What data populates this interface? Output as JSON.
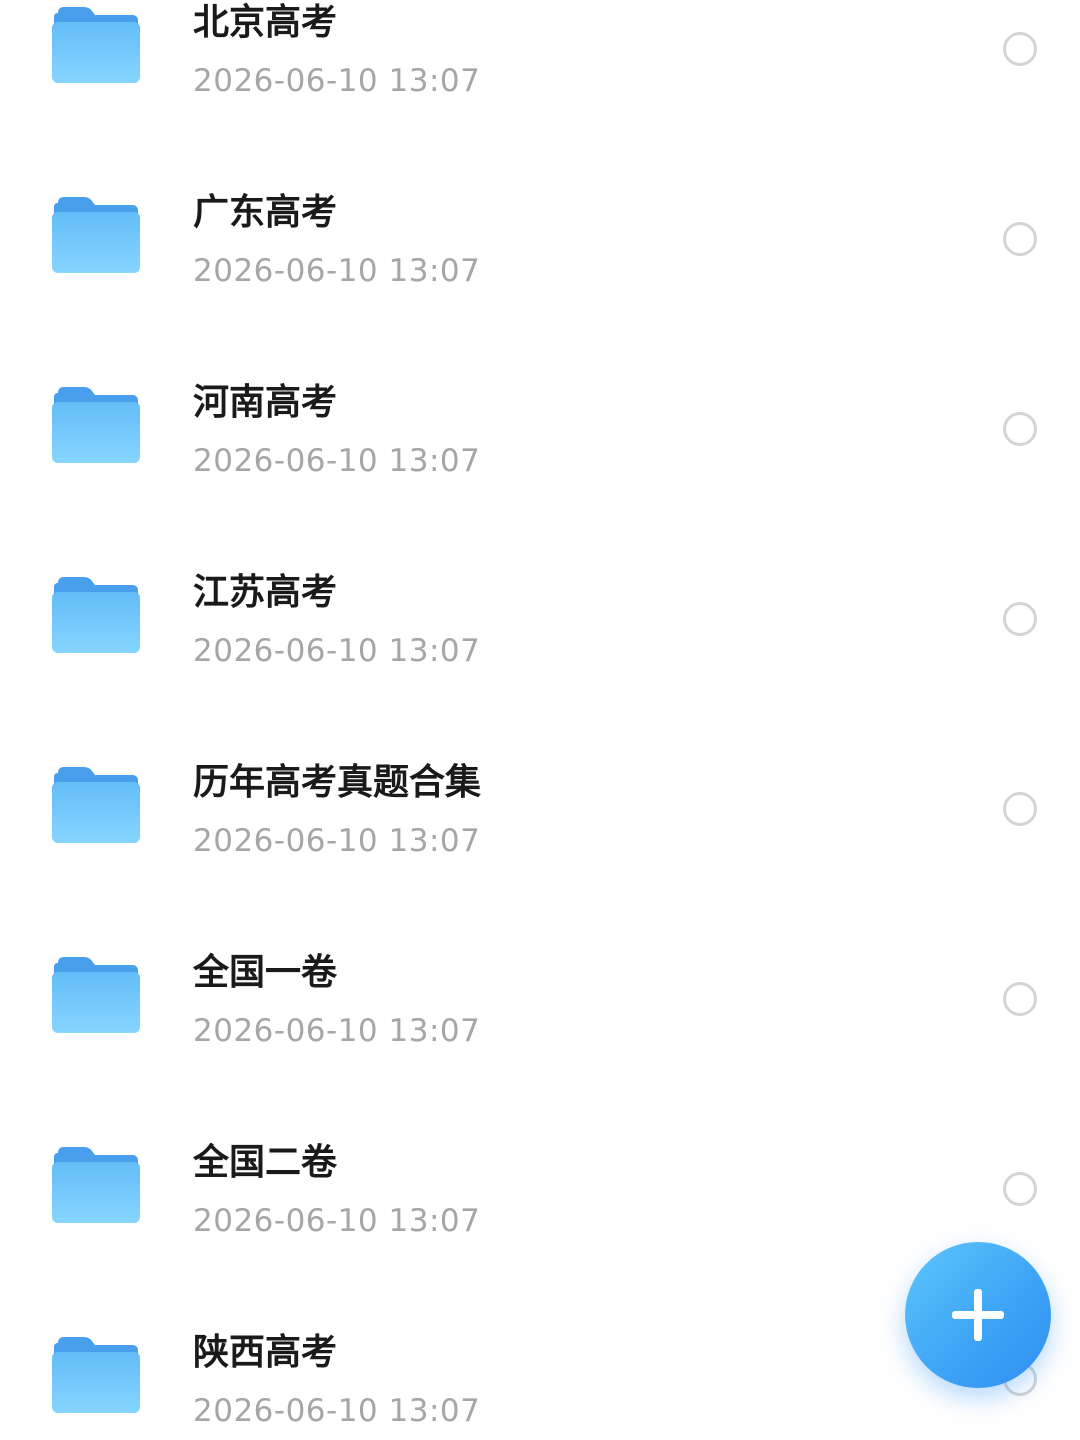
{
  "folders": [
    {
      "name": "北京高考",
      "date": "2026-06-10 13:07"
    },
    {
      "name": "广东高考",
      "date": "2026-06-10 13:07"
    },
    {
      "name": "河南高考",
      "date": "2026-06-10 13:07"
    },
    {
      "name": "江苏高考",
      "date": "2026-06-10 13:07"
    },
    {
      "name": "历年高考真题合集",
      "date": "2026-06-10 13:07"
    },
    {
      "name": "全国一卷",
      "date": "2026-06-10 13:07"
    },
    {
      "name": "全国二卷",
      "date": "2026-06-10 13:07"
    },
    {
      "name": "陕西高考",
      "date": "2026-06-10 13:07"
    }
  ],
  "icons": {
    "folder": "folder-icon",
    "select": "circle-outline-icon",
    "fab": "plus-icon"
  },
  "colors": {
    "folder_light": "#7fd0ff",
    "folder_dark": "#4aa4ef",
    "title": "#1a1a1a",
    "date": "#a6a6a6",
    "circle": "#d4d4d4",
    "fab": "#3ea5f6"
  }
}
